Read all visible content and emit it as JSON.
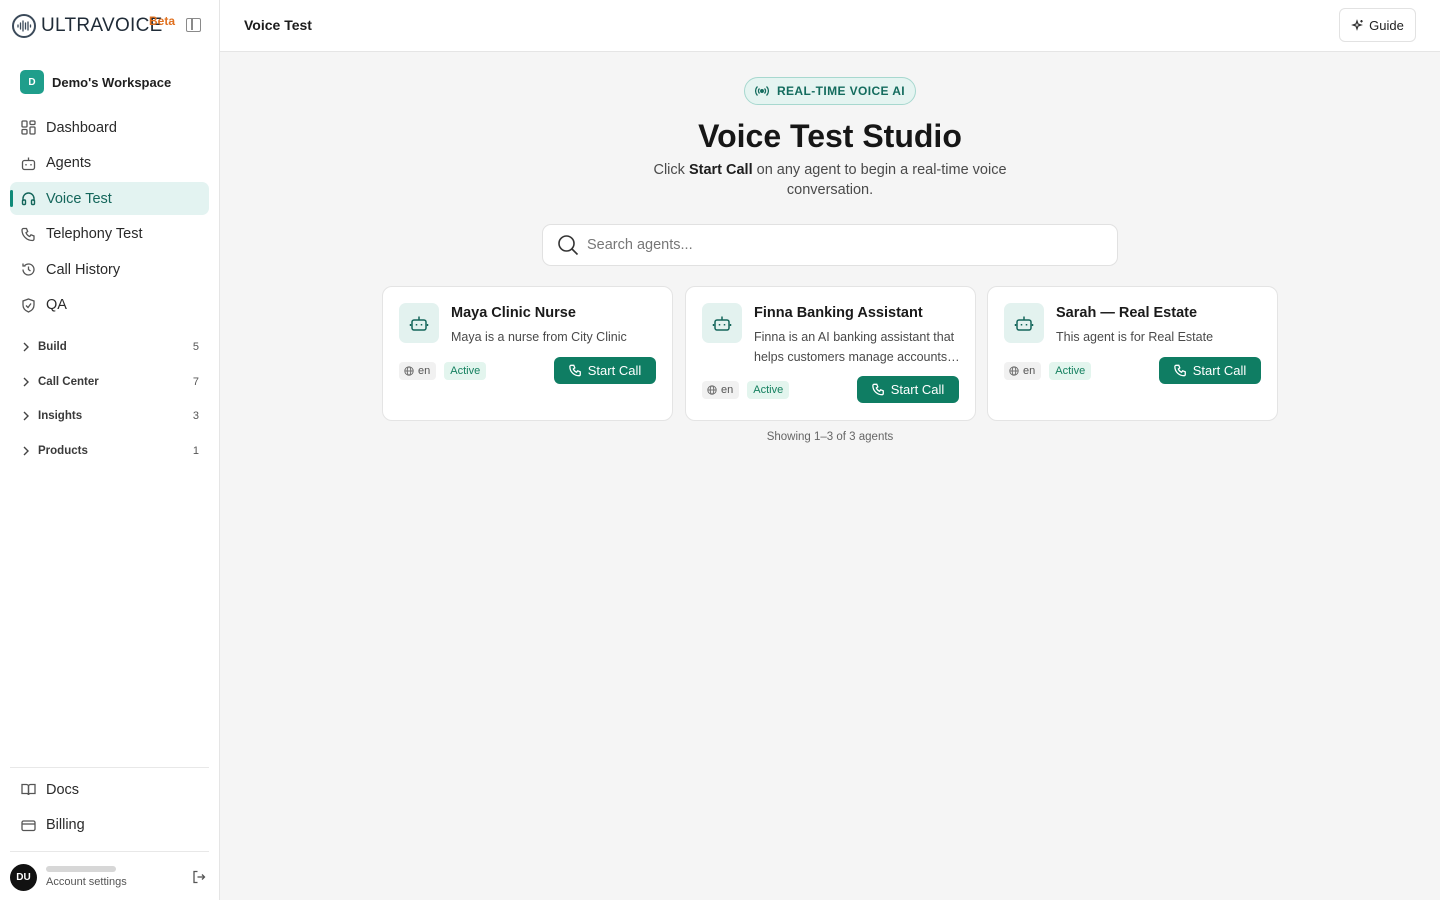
{
  "brand": {
    "name": "ULTRAVOICE",
    "badge": "Beta"
  },
  "workspace": {
    "initial": "D",
    "name": "Demo's Workspace"
  },
  "nav": [
    {
      "label": "Dashboard",
      "icon": "dashboard-icon"
    },
    {
      "label": "Agents",
      "icon": "bot-icon"
    },
    {
      "label": "Voice Test",
      "icon": "headphones-icon",
      "active": true
    },
    {
      "label": "Telephony Test",
      "icon": "phone-icon"
    },
    {
      "label": "Call History",
      "icon": "history-icon"
    },
    {
      "label": "QA",
      "icon": "shield-check-icon"
    }
  ],
  "groups": [
    {
      "label": "Build",
      "count": "5"
    },
    {
      "label": "Call Center",
      "count": "7"
    },
    {
      "label": "Insights",
      "count": "3"
    },
    {
      "label": "Products",
      "count": "1"
    }
  ],
  "bottom_nav": [
    {
      "label": "Docs",
      "icon": "book-icon"
    },
    {
      "label": "Billing",
      "icon": "credit-card-icon"
    }
  ],
  "user": {
    "initials": "DU",
    "subtitle": "Account settings"
  },
  "topbar": {
    "title": "Voice Test",
    "guide_label": "Guide"
  },
  "hero": {
    "pill": "REAL-TIME VOICE AI",
    "title": "Voice Test Studio",
    "sub_prefix": "Click ",
    "sub_bold": "Start Call",
    "sub_suffix": " on any agent to begin a real-time voice conversation."
  },
  "search": {
    "placeholder": "Search agents..."
  },
  "agents": [
    {
      "name": "Maya Clinic Nurse",
      "description": "Maya is a nurse from City Clinic",
      "lang": "en",
      "status": "Active",
      "button": "Start Call"
    },
    {
      "name": "Finna Banking Assistant",
      "description": "Finna is an AI banking assistant that helps customers manage accounts, check balances and more",
      "lang": "en",
      "status": "Active",
      "button": "Start Call"
    },
    {
      "name": "Sarah — Real Estate",
      "description": "This agent is for Real Estate",
      "lang": "en",
      "status": "Active",
      "button": "Start Call"
    }
  ],
  "footer": {
    "showing": "Showing 1–3 of 3 agents"
  },
  "colors": {
    "accent": "#0f7d63",
    "active_bg": "#e3f3f1",
    "beta": "#e0701f"
  }
}
